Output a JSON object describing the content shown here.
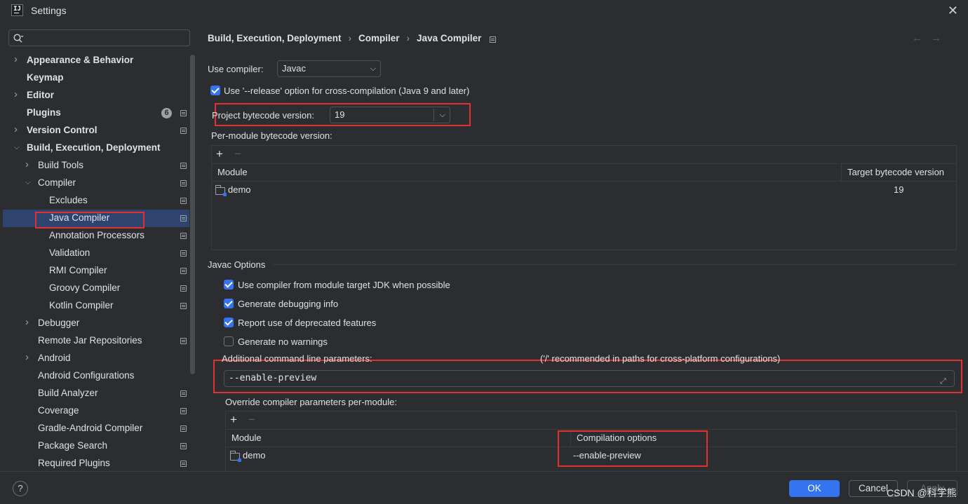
{
  "window": {
    "title": "Settings"
  },
  "sidebar": {
    "search_placeholder": "",
    "items": [
      {
        "label": "Appearance & Behavior",
        "level": 0,
        "bold": true,
        "chevron": "right"
      },
      {
        "label": "Keymap",
        "level": 0,
        "bold": true,
        "chevron": ""
      },
      {
        "label": "Editor",
        "level": 0,
        "bold": true,
        "chevron": "right"
      },
      {
        "label": "Plugins",
        "level": 0,
        "bold": true,
        "chevron": "",
        "badge": "6",
        "page_icon": true
      },
      {
        "label": "Version Control",
        "level": 0,
        "bold": true,
        "chevron": "right",
        "page_icon": true
      },
      {
        "label": "Build, Execution, Deployment",
        "level": 0,
        "bold": true,
        "chevron": "down"
      },
      {
        "label": "Build Tools",
        "level": 1,
        "chevron": "right",
        "page_icon": true
      },
      {
        "label": "Compiler",
        "level": 1,
        "chevron": "down",
        "page_icon": true
      },
      {
        "label": "Excludes",
        "level": 2,
        "page_icon": true
      },
      {
        "label": "Java Compiler",
        "level": 2,
        "selected": true,
        "page_icon": true
      },
      {
        "label": "Annotation Processors",
        "level": 2,
        "page_icon": true
      },
      {
        "label": "Validation",
        "level": 2,
        "page_icon": true
      },
      {
        "label": "RMI Compiler",
        "level": 2,
        "page_icon": true
      },
      {
        "label": "Groovy Compiler",
        "level": 2,
        "page_icon": true
      },
      {
        "label": "Kotlin Compiler",
        "level": 2,
        "page_icon": true
      },
      {
        "label": "Debugger",
        "level": 1,
        "chevron": "right"
      },
      {
        "label": "Remote Jar Repositories",
        "level": 1,
        "page_icon": true
      },
      {
        "label": "Android",
        "level": 1,
        "chevron": "right"
      },
      {
        "label": "Android Configurations",
        "level": 1
      },
      {
        "label": "Build Analyzer",
        "level": 1,
        "page_icon": true
      },
      {
        "label": "Coverage",
        "level": 1,
        "page_icon": true
      },
      {
        "label": "Gradle-Android Compiler",
        "level": 1,
        "page_icon": true
      },
      {
        "label": "Package Search",
        "level": 1,
        "page_icon": true
      },
      {
        "label": "Required Plugins",
        "level": 1,
        "page_icon": true
      }
    ]
  },
  "breadcrumb": [
    "Build, Execution, Deployment",
    "Compiler",
    "Java Compiler"
  ],
  "nav": {
    "back": "←",
    "forward": "→"
  },
  "compiler": {
    "use_compiler_label": "Use compiler:",
    "use_compiler_value": "Javac",
    "release_option_label": "Use '--release' option for cross-compilation (Java 9 and later)",
    "release_option_checked": true,
    "bytecode_label": "Project bytecode version:",
    "bytecode_value": "19",
    "per_module_label": "Per-module bytecode version:",
    "module_table": {
      "columns": [
        "Module",
        "Target bytecode version"
      ],
      "rows": [
        {
          "module": "demo",
          "target": "19"
        }
      ]
    }
  },
  "javac": {
    "section_title": "Javac Options",
    "options": [
      {
        "label": "Use compiler from module target JDK when possible",
        "checked": true
      },
      {
        "label": "Generate debugging info",
        "checked": true
      },
      {
        "label": "Report use of deprecated features",
        "checked": true
      },
      {
        "label": "Generate no warnings",
        "checked": false
      }
    ],
    "additional_params_label": "Additional command line parameters:",
    "additional_params_hint": "('/' recommended in paths for cross-platform configurations)",
    "additional_params_value": "--enable-preview",
    "override_label": "Override compiler parameters per-module:",
    "override_table": {
      "columns": [
        "Module",
        "Compilation options"
      ],
      "rows": [
        {
          "module": "demo",
          "options": "--enable-preview"
        }
      ]
    }
  },
  "footer": {
    "help": "?",
    "ok": "OK",
    "cancel": "Cancel",
    "apply": "Apply",
    "watermark": "CSDN @科学熊"
  },
  "colors": {
    "accent": "#3574f0",
    "highlight_box": "#e03030",
    "selection": "#2e436e",
    "background": "#2b2d30"
  }
}
